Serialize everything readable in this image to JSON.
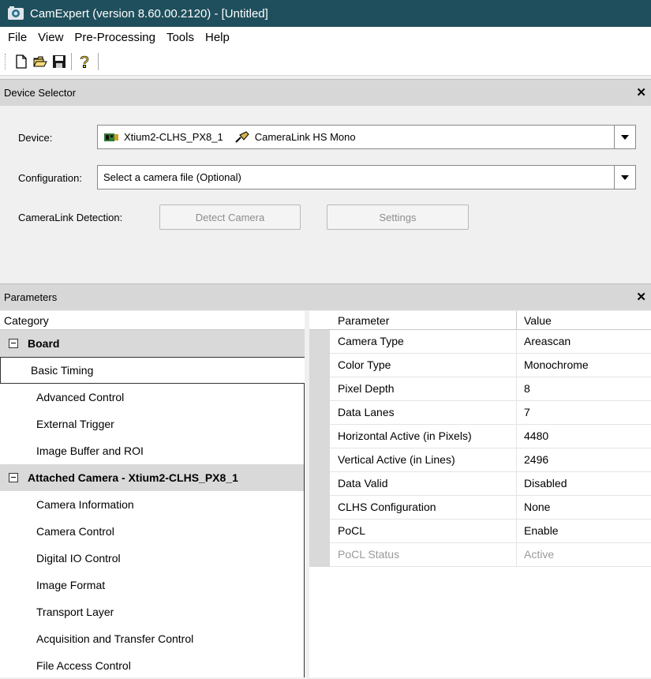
{
  "window": {
    "title": "CamExpert (version 8.60.00.2120) - [Untitled]"
  },
  "menu": [
    "File",
    "View",
    "Pre-Processing",
    "Tools",
    "Help"
  ],
  "toolbar": {
    "icons": [
      "new-file-icon",
      "open-folder-icon",
      "save-icon",
      "help-icon"
    ]
  },
  "device_selector": {
    "title": "Device Selector",
    "device_label": "Device:",
    "device_value": "Xtium2-CLHS_PX8_1",
    "device_interface": "CameraLink HS Mono",
    "config_label": "Configuration:",
    "config_value": "Select a camera file (Optional)",
    "detection_label": "CameraLink Detection:",
    "detect_button": "Detect Camera",
    "settings_button": "Settings"
  },
  "parameters": {
    "title": "Parameters",
    "category_header": "Category",
    "parameter_header": "Parameter",
    "value_header": "Value",
    "groups": [
      {
        "label": "Board",
        "items": [
          "Basic Timing",
          "Advanced Control",
          "External Trigger",
          "Image Buffer and ROI"
        ]
      },
      {
        "label": "Attached Camera - Xtium2-CLHS_PX8_1",
        "items": [
          "Camera Information",
          "Camera Control",
          "Digital IO Control",
          "Image Format",
          "Transport Layer",
          "Acquisition and Transfer Control",
          "File Access Control"
        ]
      }
    ],
    "selected_item": "Basic Timing",
    "rows": [
      {
        "name": "Camera Type",
        "value": "Areascan"
      },
      {
        "name": "Color Type",
        "value": "Monochrome"
      },
      {
        "name": "Pixel Depth",
        "value": "8"
      },
      {
        "name": "Data Lanes",
        "value": "7"
      },
      {
        "name": "Horizontal Active (in Pixels)",
        "value": "4480"
      },
      {
        "name": "Vertical Active (in Lines)",
        "value": "2496"
      },
      {
        "name": "Data Valid",
        "value": "Disabled"
      },
      {
        "name": "CLHS Configuration",
        "value": "None"
      },
      {
        "name": "PoCL",
        "value": "Enable"
      },
      {
        "name": "PoCL Status",
        "value": "Active"
      }
    ]
  }
}
